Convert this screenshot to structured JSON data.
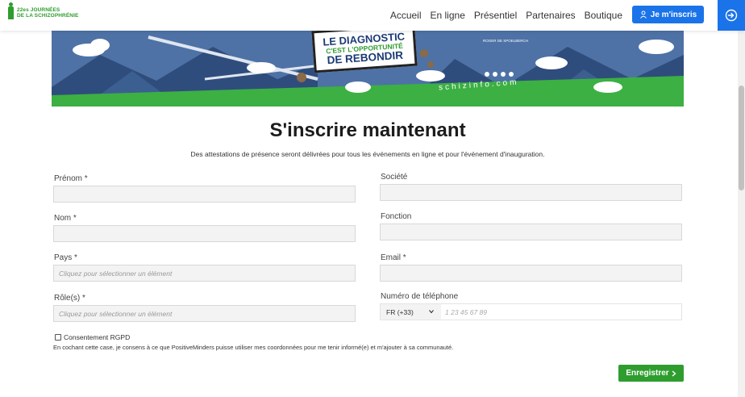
{
  "header": {
    "logo_line1": "22es JOURNÉES",
    "logo_line2": "DE LA SCHIZOPHRÉNIE",
    "nav": [
      "Accueil",
      "En ligne",
      "Présentiel",
      "Partenaires",
      "Boutique"
    ],
    "signup_label": "Je m'inscris",
    "login_icon": "login-arrow-icon"
  },
  "banner": {
    "line1": "LE DIAGNOSTIC",
    "line2": "C'EST L'OPPORTUNITÉ",
    "line3": "DE REBONDIR",
    "url": "schizinfo.com",
    "sponsor": "ROGER DE SPOELBERCH"
  },
  "form": {
    "title": "S'inscrire maintenant",
    "subtitle": "Des attestations de présence seront délivrées pour tous les événements en ligne et pour l'événement d'inauguration.",
    "fields": {
      "prenom": {
        "label": "Prénom",
        "required": "*"
      },
      "nom": {
        "label": "Nom",
        "required": "*"
      },
      "pays": {
        "label": "Pays",
        "required": "*",
        "placeholder": "Cliquez pour sélectionner un élément"
      },
      "roles": {
        "label": "Rôle(s)",
        "required": "*",
        "placeholder": "Cliquez pour sélectionner un élément"
      },
      "societe": {
        "label": "Société"
      },
      "fonction": {
        "label": "Fonction"
      },
      "email": {
        "label": "Email",
        "required": "*"
      },
      "telephone": {
        "label": "Numéro de téléphone",
        "code": "FR (+33)",
        "placeholder": "1 23 45 67 89"
      }
    },
    "consent_label": "Consentement RGPD",
    "consent_text": "En cochant cette case, je consens à ce que PositiveMinders puisse utiliser mes coordonnées pour me tenir informé(e) et m'ajouter à sa communauté.",
    "submit_label": "Enregistrer"
  },
  "colors": {
    "accent_blue": "#1a73e8",
    "accent_green": "#2e9d2e"
  }
}
